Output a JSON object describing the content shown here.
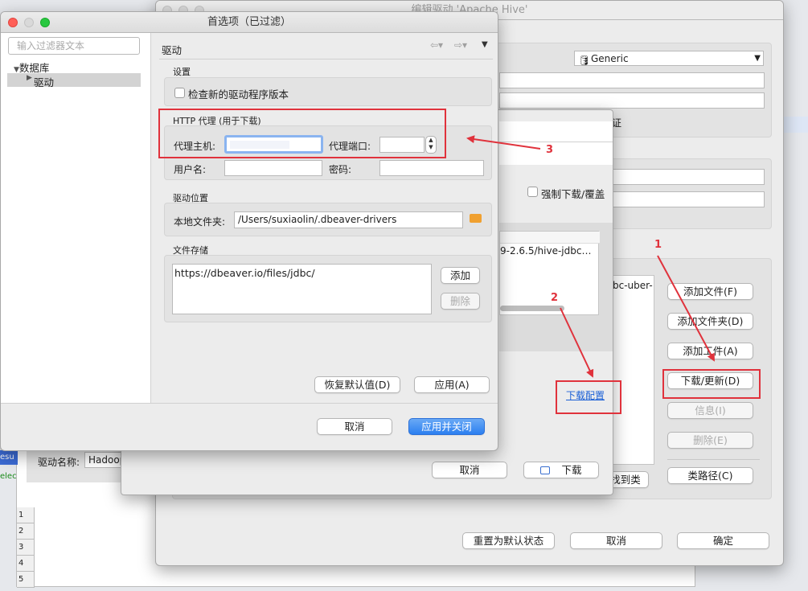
{
  "edit_driver": {
    "title": "编辑驱动 'Apache Hive'",
    "driver_type": "Generic",
    "cert_suffix": "证",
    "force_download_label": "强制下载/覆盖",
    "jar_path_text": "9-2.6.5/hive-jdbc…",
    "jar_path_side_text": "bc-uber-",
    "buttons": {
      "add_file": "添加文件(F)",
      "add_folder": "添加文件夹(D)",
      "add_artifact": "添加工件(A)",
      "download_update": "下载/更新(D)",
      "info": "信息(I)",
      "delete": "删除(E)",
      "find_class": "找到类",
      "classpath": "类路径(C)",
      "reset_default": "重置为默认状态",
      "cancel": "取消",
      "ok": "确定"
    },
    "driver_name_label": "驱动名称:",
    "driver_name_value": "Hadoop",
    "download_config_link": "下载配置"
  },
  "download_dialog": {
    "cancel": "取消",
    "download": "下载"
  },
  "background_table": {
    "sel_text": "esu",
    "green_text": "elec",
    "row_numbers": [
      "1",
      "2",
      "3",
      "4",
      "5"
    ]
  },
  "prefs": {
    "title": "首选项（已过滤）",
    "filter_placeholder": "输入过滤器文本",
    "tree": {
      "root": "数据库",
      "child": "驱动"
    },
    "section_title": "驱动",
    "settings_header": "设置",
    "check_new_versions": "检查新的驱动程序版本",
    "http_proxy_header": "HTTP 代理 (用于下载)",
    "proxy_host_label": "代理主机:",
    "proxy_port_label": "代理端口:",
    "username_label": "用户名:",
    "password_label": "密码:",
    "driver_location_header": "驱动位置",
    "local_folder_label": "本地文件夹:",
    "local_folder_value": "/Users/suxiaolin/.dbeaver-drivers",
    "file_storage_header": "文件存储",
    "file_storage_item": "https://dbeaver.io/files/jdbc/",
    "add_button": "添加",
    "delete_button": "删除",
    "restore_defaults": "恢复默认值(D)",
    "apply": "应用(A)",
    "cancel": "取消",
    "apply_close": "应用并关闭"
  },
  "annotations": {
    "n1": "1",
    "n2": "2",
    "n3": "3",
    "color": "#e0323c"
  }
}
